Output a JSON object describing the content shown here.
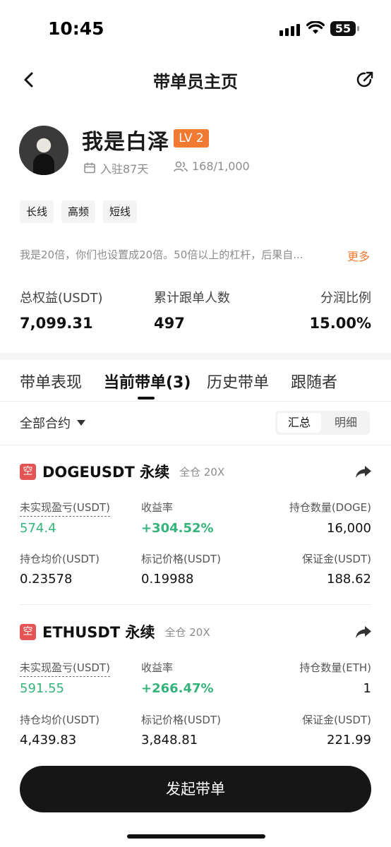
{
  "status": {
    "time": "10:45",
    "battery": "55"
  },
  "nav": {
    "title": "带单员主页"
  },
  "profile": {
    "name": "我是白泽",
    "level": "LV 2",
    "days": "入驻87天",
    "followers": "168/1,000",
    "tags": [
      "长线",
      "高频",
      "短线"
    ],
    "bio": "我是20倍，你们也设置成20倍。50倍以上的杠杆，后果自...",
    "more": "更多"
  },
  "stats": [
    {
      "label": "总权益(USDT)",
      "value": "7,099.31"
    },
    {
      "label": "累计跟单人数",
      "value": "497"
    },
    {
      "label": "分润比例",
      "value": "15.00%"
    }
  ],
  "tabs": [
    "带单表现",
    "当前带单(3)",
    "历史带单",
    "跟随者"
  ],
  "filter": {
    "label": "全部合约",
    "toggle": [
      "汇总",
      "明细"
    ]
  },
  "positions": [
    {
      "side": "空",
      "symbol": "DOGEUSDT 永续",
      "mode": "全仓 20X",
      "pnl_label": "未实现盈亏(USDT)",
      "pnl": "574.4",
      "roe_label": "收益率",
      "roe": "+304.52%",
      "size_label": "持仓数量(DOGE)",
      "size": "16,000",
      "entry_label": "持仓均价(USDT)",
      "entry": "0.23578",
      "mark_label": "标记价格(USDT)",
      "mark": "0.19988",
      "margin_label": "保证金(USDT)",
      "margin": "188.62"
    },
    {
      "side": "空",
      "symbol": "ETHUSDT 永续",
      "mode": "全仓 20X",
      "pnl_label": "未实现盈亏(USDT)",
      "pnl": "591.55",
      "roe_label": "收益率",
      "roe": "+266.47%",
      "size_label": "持仓数量(ETH)",
      "size": "1",
      "entry_label": "持仓均价(USDT)",
      "entry": "4,439.83",
      "mark_label": "标记价格(USDT)",
      "mark": "3,848.81",
      "margin_label": "保证金(USDT)",
      "margin": "221.99"
    }
  ],
  "cta": {
    "label": "发起带单"
  },
  "colors": {
    "accent": "#f07a31",
    "profit": "#34b47a",
    "short": "#e45454"
  }
}
